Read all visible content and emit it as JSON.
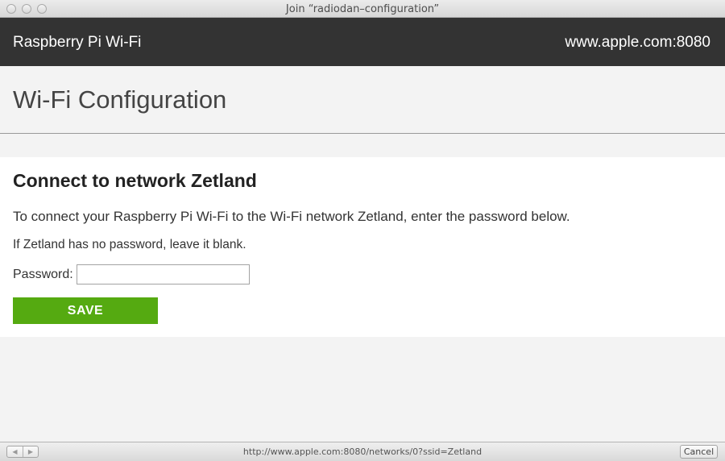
{
  "window": {
    "title": "Join “radiodan–configuration”"
  },
  "header": {
    "brand": "Raspberry Pi Wi-Fi",
    "host": "www.apple.com:8080"
  },
  "page": {
    "title": "Wi-Fi Configuration"
  },
  "form": {
    "heading": "Connect to network Zetland",
    "intro": "To connect your Raspberry Pi Wi-Fi to the Wi-Fi network Zetland, enter the password below.",
    "note": "If Zetland has no password, leave it blank.",
    "password_label": "Password:",
    "password_value": "",
    "save_label": "SAVE"
  },
  "statusbar": {
    "url": "http://www.apple.com:8080/networks/0?ssid=Zetland",
    "back_icon": "◀",
    "forward_icon": "▶",
    "cancel_label": "Cancel"
  },
  "colors": {
    "header_bg": "#333333",
    "save_button": "#55aa11",
    "page_bg": "#f3f3f3"
  }
}
